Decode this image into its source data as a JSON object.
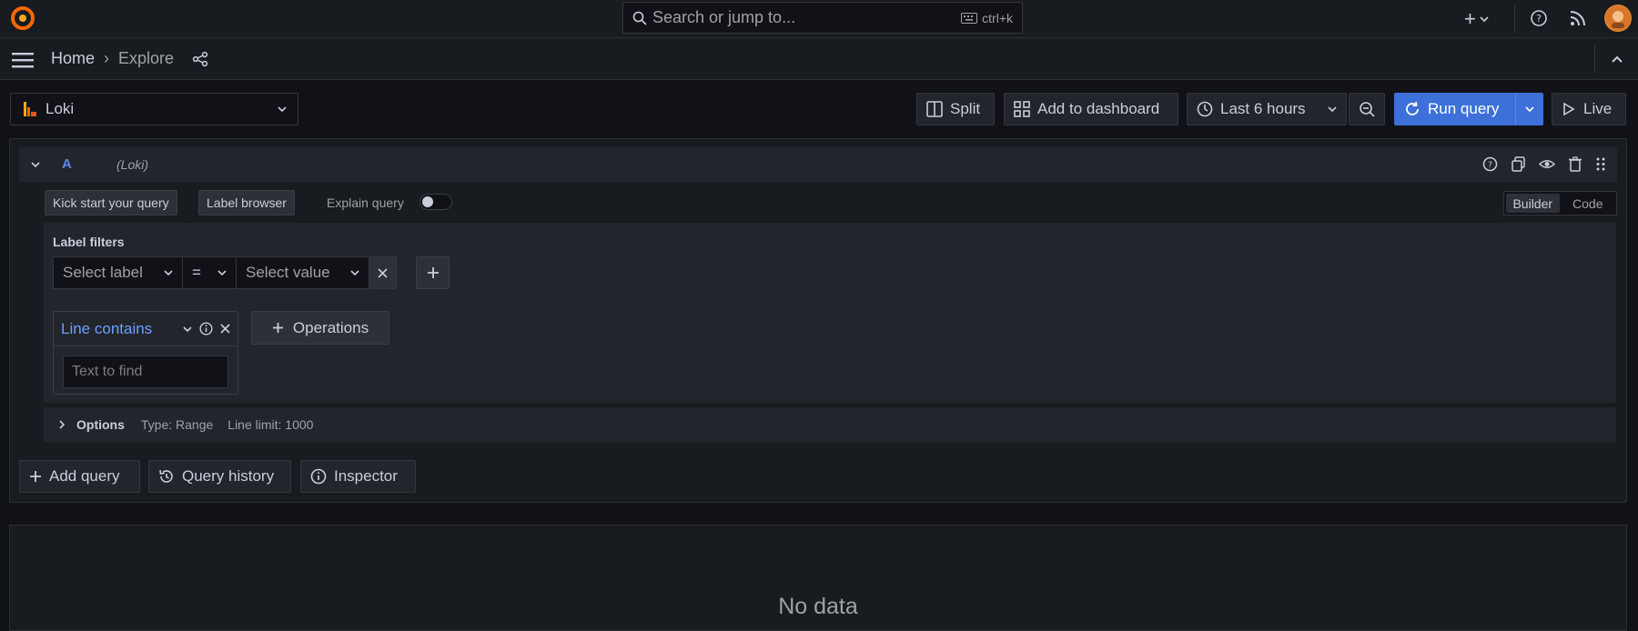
{
  "topbar": {
    "search_placeholder": "Search or jump to...",
    "search_shortcut": "ctrl+k"
  },
  "breadcrumb": {
    "home": "Home",
    "separator": "›",
    "current": "Explore"
  },
  "toolbar": {
    "datasource": "Loki",
    "split": "Split",
    "add_to_dashboard": "Add to dashboard",
    "time_range": "Last 6 hours",
    "run_query": "Run query",
    "live": "Live"
  },
  "query": {
    "ref_id": "A",
    "datasource_tag": "(Loki)",
    "kick_start": "Kick start your query",
    "label_browser": "Label browser",
    "explain_query": "Explain query",
    "mode_builder": "Builder",
    "mode_code": "Code",
    "label_filters_title": "Label filters",
    "select_label": "Select label",
    "operator": "=",
    "select_value": "Select value",
    "line_contains": "Line contains",
    "text_to_find_placeholder": "Text to find",
    "operations": "Operations",
    "options_label": "Options",
    "options_type": "Type: Range",
    "options_line_limit": "Line limit: 1000"
  },
  "actions": {
    "add_query": "Add query",
    "query_history": "Query history",
    "inspector": "Inspector"
  },
  "results": {
    "empty_text": "No data"
  },
  "colors": {
    "accent": "#3d71d9",
    "brand": "#f46800",
    "background": "#111217",
    "panel": "#181b1f"
  }
}
